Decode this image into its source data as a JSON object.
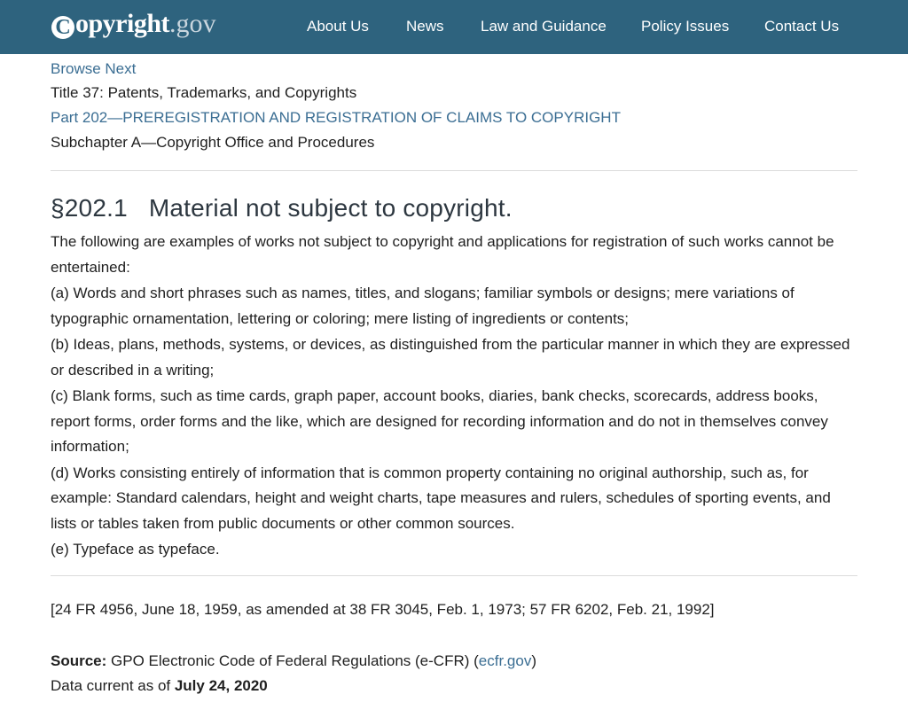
{
  "header": {
    "logo_word": "opyright",
    "logo_c": "C",
    "logo_tld": ".gov",
    "nav": [
      {
        "label": "About Us"
      },
      {
        "label": "News"
      },
      {
        "label": "Law and Guidance"
      },
      {
        "label": "Policy Issues"
      },
      {
        "label": "Contact Us"
      }
    ]
  },
  "breadcrumbs": {
    "browse_next": "Browse Next",
    "title": "Title 37: Patents, Trademarks, and Copyrights",
    "part": "Part 202—PREREGISTRATION AND REGISTRATION OF CLAIMS TO COPYRIGHT",
    "subchapter": "Subchapter A—Copyright Office and Procedures"
  },
  "section": {
    "number": "§202.1",
    "heading": "Material not subject to copyright.",
    "paragraphs": [
      "The following are examples of works not subject to copyright and applications for registration of such works cannot be entertained:",
      "(a) Words and short phrases such as names, titles, and slogans; familiar symbols or designs; mere variations of typographic ornamentation, lettering or coloring; mere listing of ingredients or contents;",
      "(b) Ideas, plans, methods, systems, or devices, as distinguished from the particular manner in which they are expressed or described in a writing;",
      "(c) Blank forms, such as time cards, graph paper, account books, diaries, bank checks, scorecards, address books, report forms, order forms and the like, which are designed for recording information and do not in themselves convey information;",
      "(d) Works consisting entirely of information that is common property containing no original authorship, such as, for example: Standard calendars, height and weight charts, tape measures and rulers, schedules of sporting events, and lists or tables taken from public documents or other common sources.",
      "(e) Typeface as typeface."
    ],
    "citation": "[24 FR 4956, June 18, 1959, as amended at 38 FR 3045, Feb. 1, 1973; 57 FR 6202, Feb. 21, 1992]"
  },
  "source": {
    "label": "Source:",
    "text": " GPO Electronic Code of Federal Regulations (e-CFR) (",
    "link": "ecfr.gov",
    "close": ")",
    "current_prefix": "Data current as of ",
    "current_date": "July 24, 2020"
  },
  "colors": {
    "header_bg": "#2e637e",
    "link": "#3b6e93"
  }
}
